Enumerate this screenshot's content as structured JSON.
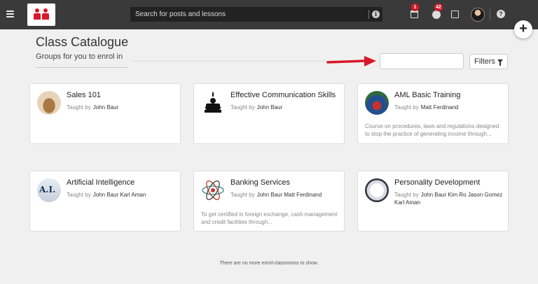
{
  "topbar": {
    "search_placeholder": "Search for posts and lessons",
    "info_glyph": "i",
    "calendar_badge": "1",
    "globe_badge": "42",
    "help_glyph": "?",
    "icons": [
      "menu-icon",
      "calendar-icon",
      "globe-icon",
      "notes-icon",
      "help-icon"
    ]
  },
  "fab_glyph": "+",
  "header": {
    "title": "Class Catalogue",
    "subtitle": "Groups for you to enrol in"
  },
  "filters": {
    "search_value": "",
    "button_label": "Filters"
  },
  "taught_by_label": "Taught by",
  "courses": [
    {
      "name": "Sales 101",
      "teachers": "John Baur",
      "description": ""
    },
    {
      "name": "Effective Communication Skills",
      "teachers": "John Baur",
      "description": ""
    },
    {
      "name": "AML Basic Training",
      "teachers": "Matt Ferdinand",
      "description": "Course on procedures, laws and regulations designed to stop the practice of generating income through..."
    },
    {
      "name": "Artificial Intelligence",
      "teachers": "John Baur Karl Aman",
      "description": ""
    },
    {
      "name": "Banking Services",
      "teachers": "John Baur Matt Ferdinand",
      "description": "To get certified in foreign exchange, cash management and credit facilities through..."
    },
    {
      "name": "Personality Development",
      "teachers": "John Baur Kim Ro Jason Gomez Karl Aman",
      "description": ""
    }
  ],
  "ai_thumb_text": "A.I.",
  "footer_message": "There are no more enrol-classrooms to show.",
  "colors": {
    "topbar": "#3a3a3a",
    "brand_red": "#d7192a",
    "page_bg": "#f0f0f0",
    "card_bg": "#ffffff"
  }
}
